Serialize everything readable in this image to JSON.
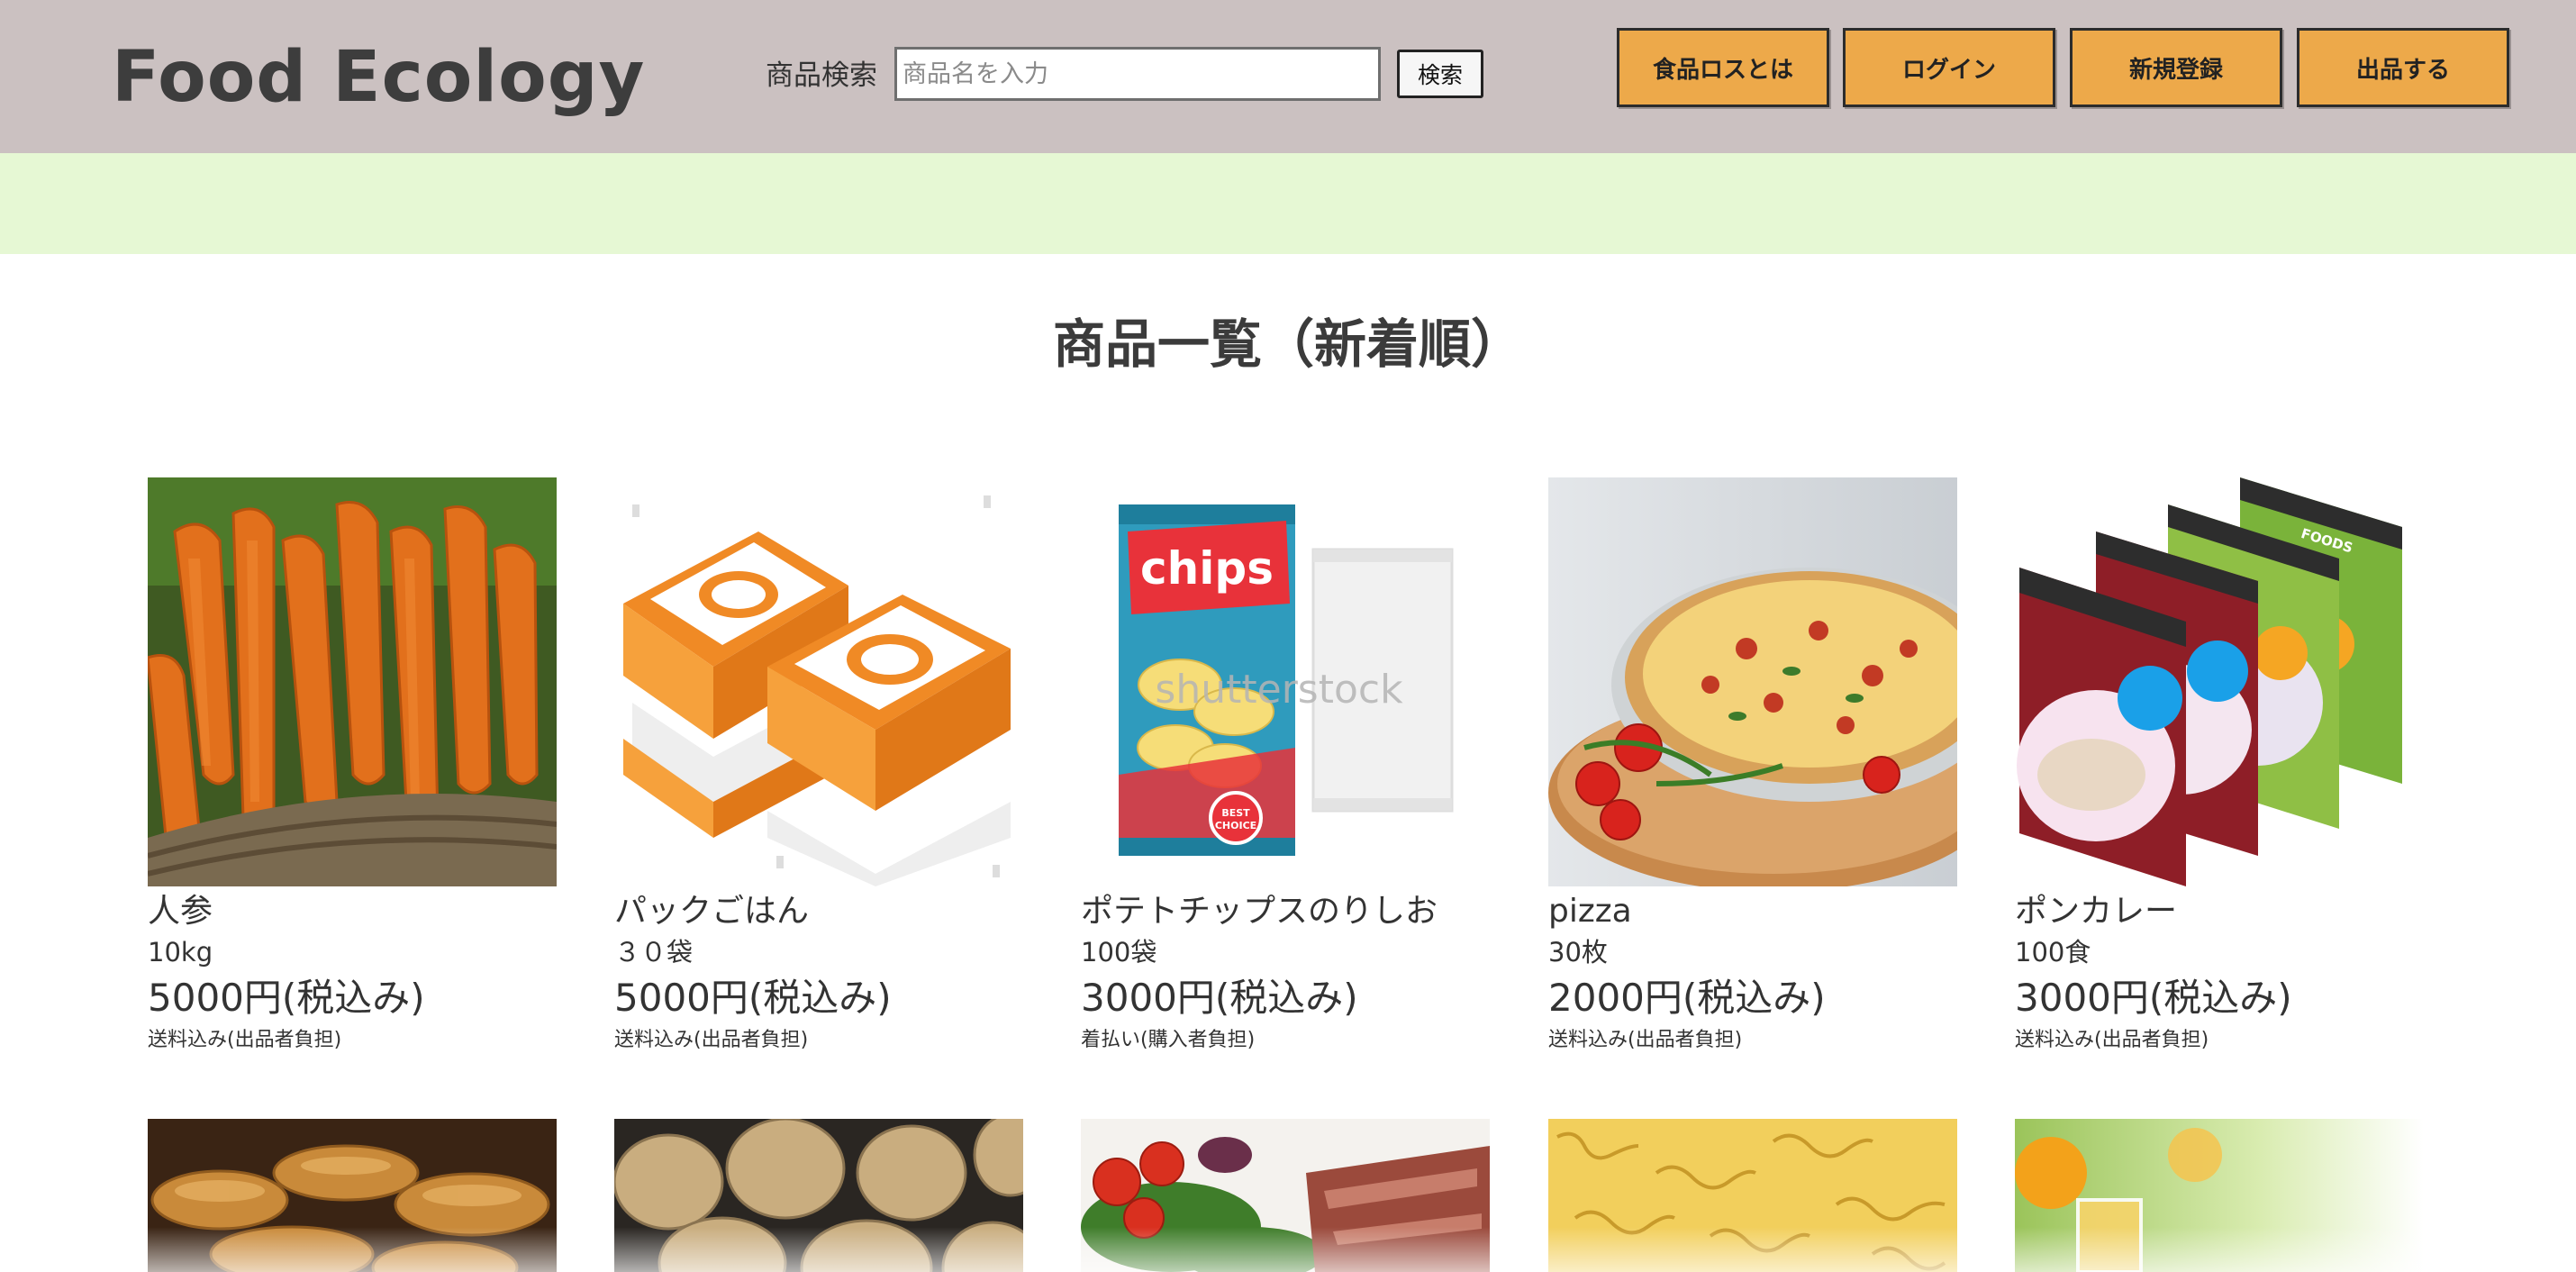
{
  "header": {
    "logo": "Food Ecology",
    "search_label": "商品検索",
    "search_placeholder": "商品名を入力",
    "search_value": "",
    "search_button": "検索",
    "nav": [
      "食品ロスとは",
      "ログイン",
      "新規登録",
      "出品する"
    ]
  },
  "colors": {
    "header_bg": "#cbc1c1",
    "banner_bg": "#e6f8d4",
    "nav_button_bg": "#eda94a"
  },
  "main": {
    "title": "商品一覧（新着順）",
    "products": [
      {
        "name": "人参",
        "quantity": "10kg",
        "price": "5000円(税込み)",
        "shipping": "送料込み(出品者負担)",
        "image_icon": "carrots-photo"
      },
      {
        "name": "パックごはん",
        "quantity": "３０袋",
        "price": "5000円(税込み)",
        "shipping": "送料込み(出品者負担)",
        "image_icon": "packed-rice-illustration"
      },
      {
        "name": "ポテトチップスのりしお",
        "quantity": "100袋",
        "price": "3000円(税込み)",
        "shipping": "着払い(購入者負担)",
        "image_icon": "chips-bag-illustration",
        "image_text": [
          "chips",
          "BEST CHOICE"
        ],
        "image_watermark": "shutterstock"
      },
      {
        "name": "pizza",
        "quantity": "30枚",
        "price": "2000円(税込み)",
        "shipping": "送料込み(出品者負担)",
        "image_icon": "pizza-photo"
      },
      {
        "name": "ポンカレー",
        "quantity": "100食",
        "price": "3000円(税込み)",
        "shipping": "送料込み(出品者負担)",
        "image_icon": "curry-pouches-illustration",
        "image_text": "FOODS"
      }
    ],
    "next_row_images": [
      "bread-rolls-photo",
      "potatoes-photo",
      "salad-steak-photo",
      "fusilli-pasta-photo",
      "juice-fruit-photo"
    ]
  }
}
